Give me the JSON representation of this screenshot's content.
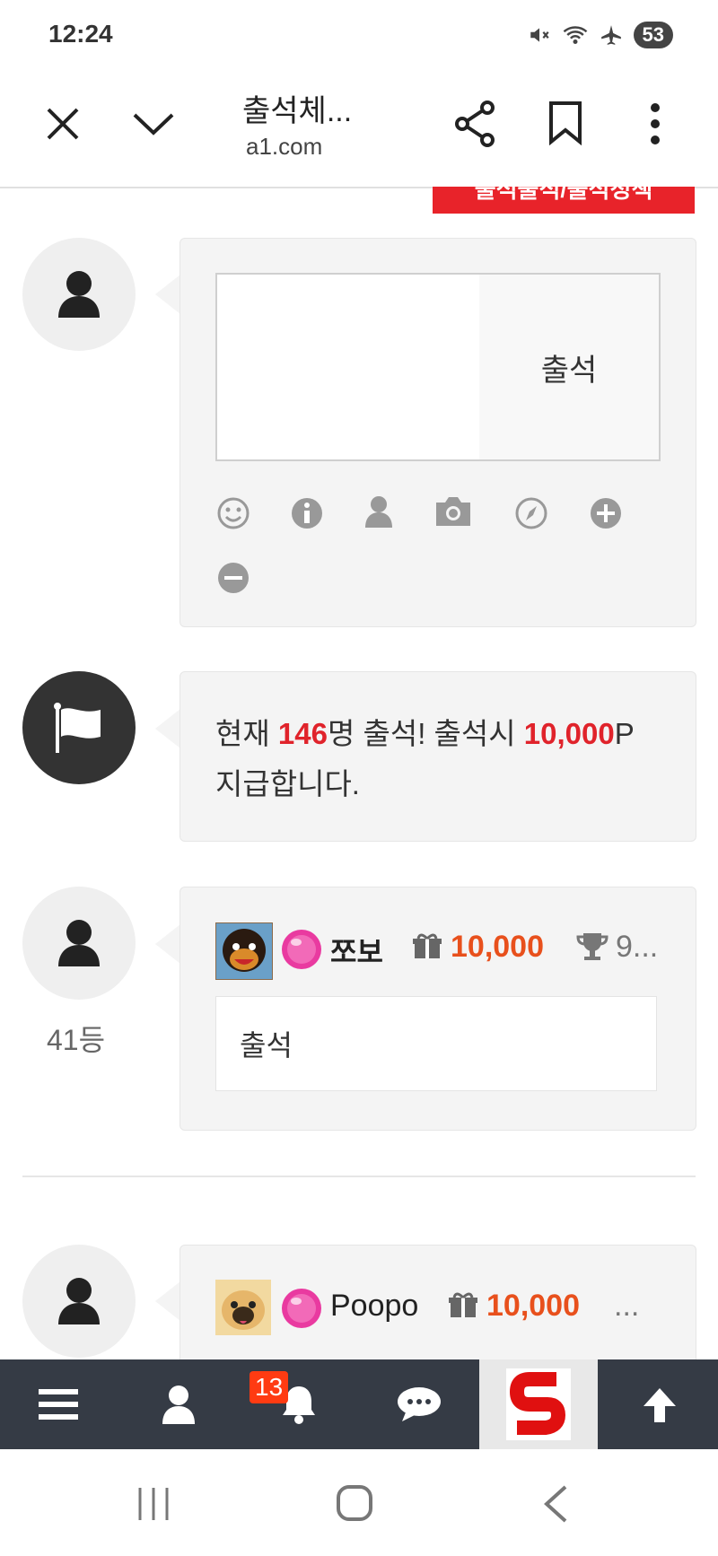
{
  "status": {
    "time": "12:24",
    "battery": "53"
  },
  "browser": {
    "title": "출석체...",
    "url": "a1.com"
  },
  "banner": {
    "label": "출석출석/출석정책"
  },
  "checkin": {
    "button_label": "출석",
    "textarea_value": ""
  },
  "notice": {
    "prefix": "현재 ",
    "count": "146",
    "mid": "명 출석! 출석시 ",
    "reward": "10,000",
    "suffix": "P",
    "line2": "지급합니다."
  },
  "entries": [
    {
      "name": "쪼보",
      "points": "10,000",
      "trophy": "9...",
      "rank": "41등",
      "comment": "출석"
    },
    {
      "name": "Poopo",
      "points": "10,000",
      "trophy": "..."
    }
  ],
  "nav": {
    "badge_count": "13"
  },
  "colors": {
    "accent_red": "#e0232b",
    "points_orange": "#e8501c",
    "nav_bg": "#353b45"
  }
}
